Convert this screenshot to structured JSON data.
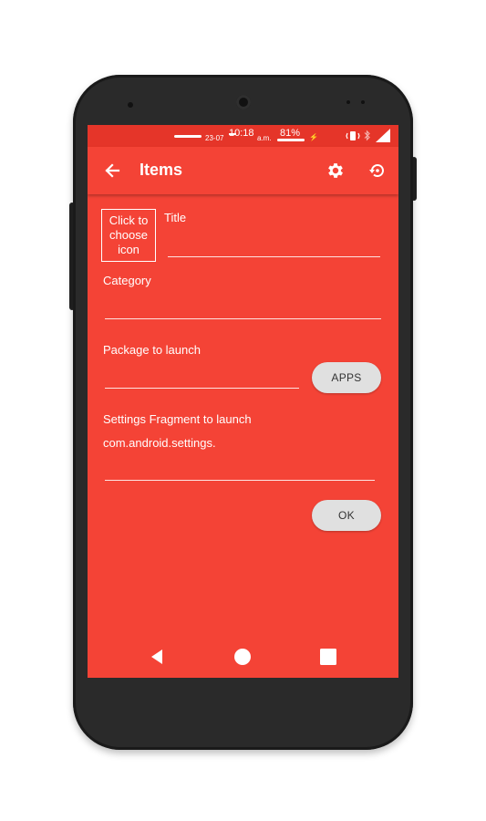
{
  "status_bar": {
    "date": "23-07",
    "time": "10:18",
    "ampm": "a.m.",
    "battery": "81%",
    "battery_level": 0.81
  },
  "toolbar": {
    "title": "Items",
    "icons": [
      "back-arrow-icon",
      "settings-gear-icon",
      "restore-icon"
    ]
  },
  "form": {
    "icon_picker_label": "Click to choose icon",
    "title_label": "Title",
    "title_value": "",
    "category_label": "Category",
    "category_value": "",
    "package_label": "Package to launch",
    "package_value": "",
    "apps_button": "APPS",
    "fragment_label": "Settings Fragment to launch",
    "fragment_value": "com.android.settings.",
    "ok_button": "OK"
  },
  "nav_bar": {
    "icons": [
      "back-triangle-icon",
      "home-circle-icon",
      "recents-square-icon"
    ]
  },
  "colors": {
    "primary": "#f44336",
    "status_bar": "#e53529",
    "button_bg": "#e0e0e0"
  }
}
